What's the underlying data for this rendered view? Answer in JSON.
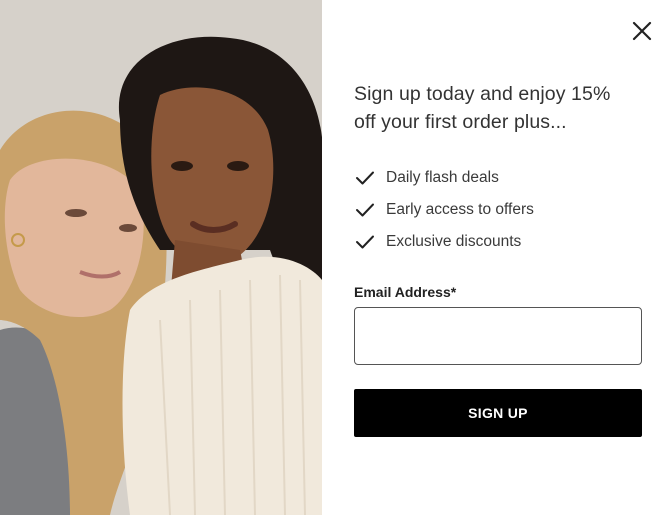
{
  "modal": {
    "headline": "Sign up today and enjoy 15% off your first order plus...",
    "benefits": [
      {
        "label": "Daily flash deals",
        "icon": "check-icon"
      },
      {
        "label": "Early access to offers",
        "icon": "check-icon"
      },
      {
        "label": "Exclusive discounts",
        "icon": "check-icon"
      }
    ],
    "email": {
      "label": "Email Address*",
      "value": "",
      "placeholder": ""
    },
    "signup_label": "SIGN UP",
    "close_icon": "close-icon"
  },
  "colors": {
    "button_bg": "#000000",
    "button_text": "#ffffff",
    "text": "#333333"
  }
}
